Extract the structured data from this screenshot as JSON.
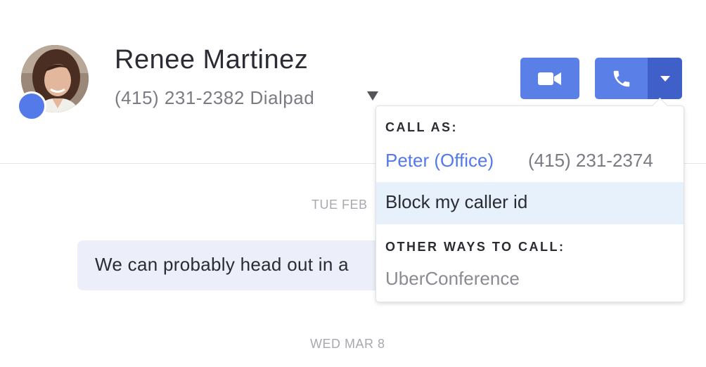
{
  "contact": {
    "name": "Renee Martinez",
    "number": "(415) 231-2382 Dialpad"
  },
  "actions": {
    "video_icon": "video-camera-icon",
    "call_icon": "phone-icon",
    "menu_icon": "caret-down-icon",
    "accent_color": "#5a7fe6"
  },
  "conversation": {
    "dates": [
      "TUE FEB",
      "WED MAR 8"
    ],
    "message": "We can probably head out in a"
  },
  "call_menu": {
    "call_as_label": "CALL AS:",
    "identity_name": "Peter (Office)",
    "identity_number": "(415) 231-2374",
    "block_label": "Block my caller id",
    "other_label": "OTHER WAYS TO CALL:",
    "uberconference_label": "UberConference"
  }
}
